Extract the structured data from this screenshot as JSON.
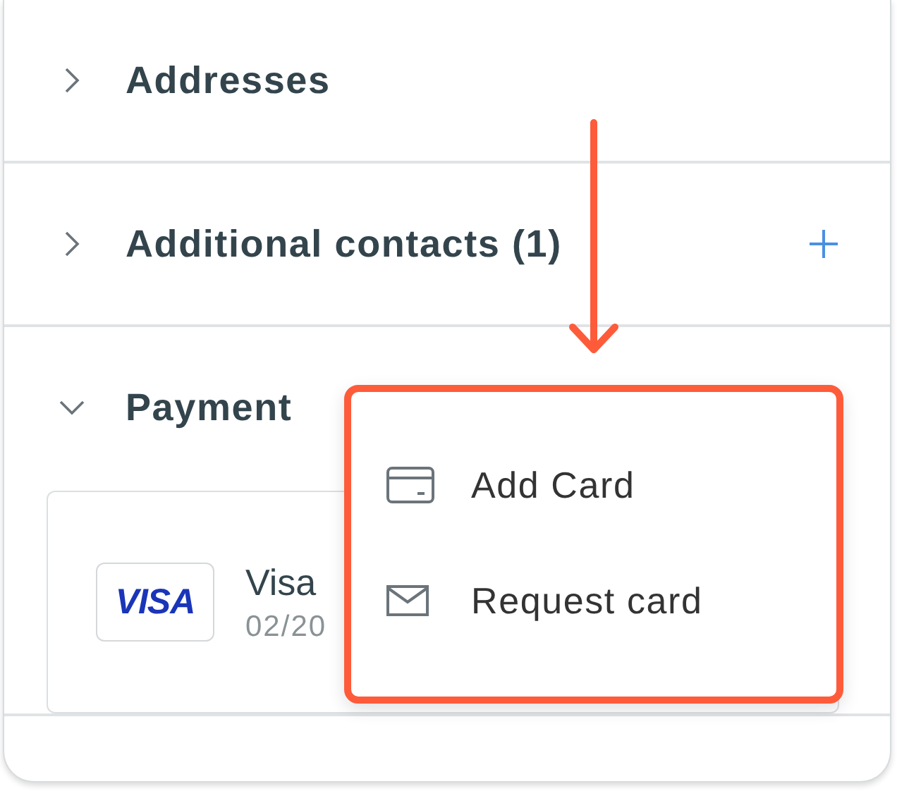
{
  "sections": [
    {
      "title": "Addresses",
      "expanded": false,
      "addable": false
    },
    {
      "title": "Additional contacts (1)",
      "expanded": false,
      "addable": true
    },
    {
      "title": "Payment",
      "expanded": true,
      "addable": false,
      "cards": [
        {
          "logo": "VISA",
          "name": "Visa",
          "expiry": "02/20"
        }
      ]
    }
  ],
  "menu": {
    "items": [
      {
        "kind": "card",
        "label": "Add Card"
      },
      {
        "kind": "mail",
        "label": "Request card"
      }
    ]
  }
}
